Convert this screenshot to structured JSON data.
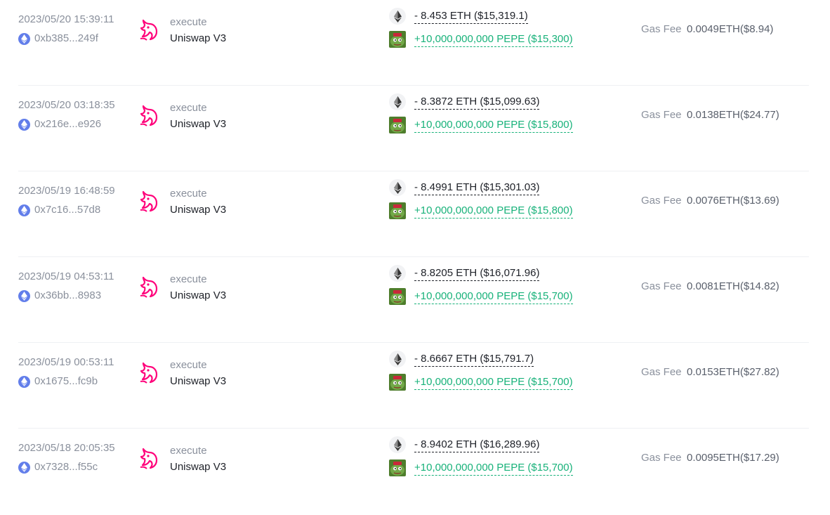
{
  "colors": {
    "uniswap_pink": "#ff007a",
    "eth_blue": "#627eea",
    "positive_green": "#18b27a",
    "muted_gray": "#8a909c"
  },
  "icons": {
    "chain": "ethereum-icon",
    "protocol": "uniswap-unicorn-icon",
    "out_token": "eth-token-icon",
    "in_token": "pepe-token-icon"
  },
  "gas_label": "Gas Fee",
  "transactions": [
    {
      "time": "2023/05/20 15:39:11",
      "hash": "0xb385...249f",
      "method": "execute",
      "protocol": "Uniswap V3",
      "out_amount": "- 8.453 ETH ($15,319.1)",
      "in_amount": "+10,000,000,000 PEPE ($15,300)",
      "gas_fee": "0.0049ETH($8.94)"
    },
    {
      "time": "2023/05/20 03:18:35",
      "hash": "0x216e...e926",
      "method": "execute",
      "protocol": "Uniswap V3",
      "out_amount": "- 8.3872 ETH ($15,099.63)",
      "in_amount": "+10,000,000,000 PEPE ($15,800)",
      "gas_fee": "0.0138ETH($24.77)"
    },
    {
      "time": "2023/05/19 16:48:59",
      "hash": "0x7c16...57d8",
      "method": "execute",
      "protocol": "Uniswap V3",
      "out_amount": "- 8.4991 ETH ($15,301.03)",
      "in_amount": "+10,000,000,000 PEPE ($15,800)",
      "gas_fee": "0.0076ETH($13.69)"
    },
    {
      "time": "2023/05/19 04:53:11",
      "hash": "0x36bb...8983",
      "method": "execute",
      "protocol": "Uniswap V3",
      "out_amount": "- 8.8205 ETH ($16,071.96)",
      "in_amount": "+10,000,000,000 PEPE ($15,700)",
      "gas_fee": "0.0081ETH($14.82)"
    },
    {
      "time": "2023/05/19 00:53:11",
      "hash": "0x1675...fc9b",
      "method": "execute",
      "protocol": "Uniswap V3",
      "out_amount": "- 8.6667 ETH ($15,791.7)",
      "in_amount": "+10,000,000,000 PEPE ($15,700)",
      "gas_fee": "0.0153ETH($27.82)"
    },
    {
      "time": "2023/05/18 20:05:35",
      "hash": "0x7328...f55c",
      "method": "execute",
      "protocol": "Uniswap V3",
      "out_amount": "- 8.9402 ETH ($16,289.96)",
      "in_amount": "+10,000,000,000 PEPE ($15,700)",
      "gas_fee": "0.0095ETH($17.29)"
    }
  ]
}
